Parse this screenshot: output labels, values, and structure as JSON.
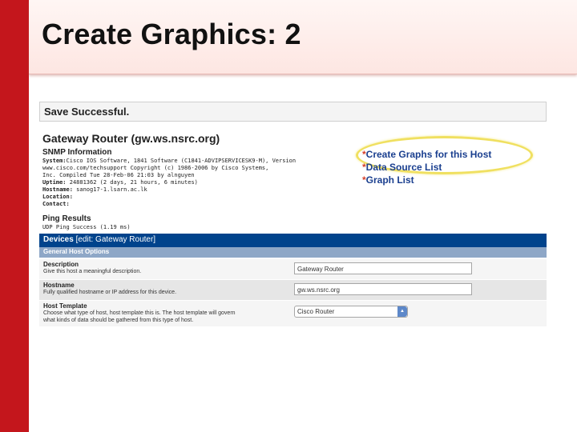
{
  "slide": {
    "title": "Create Graphics: 2"
  },
  "status": {
    "message": "Save Successful."
  },
  "host": {
    "title": "Gateway Router (gw.ws.nsrc.org)"
  },
  "snmp": {
    "heading": "SNMP Information",
    "system_label": "System:",
    "system_line1": "Cisco IOS Software, 1841 Software (C1841-ADVIPSERVICESK9-M), Version",
    "system_line2": "www.cisco.com/techsupport Copyright (c) 1986-2006 by Cisco Systems,",
    "system_line3": "Inc. Compiled Tue 28-Feb-06 21:03 by alnguyen",
    "uptime_label": "Uptime:",
    "uptime_value": "24881362 (2 days, 21 hours, 6 minutes)",
    "hostname_label": "Hostname:",
    "hostname_value": "sanog17-1.lsarn.ac.lk",
    "location_label": "Location:",
    "contact_label": "Contact:"
  },
  "actions": {
    "star": "*",
    "links": [
      "Create Graphs for this Host",
      "Data Source List",
      "Graph List"
    ]
  },
  "ping": {
    "heading": "Ping Results",
    "result": "UDP Ping Success (1.19 ms)"
  },
  "devices": {
    "header_label": "Devices",
    "header_edit": "[edit: Gateway Router]",
    "section": "General Host Options",
    "fields": [
      {
        "label": "Description",
        "desc": "Give this host a meaningful description.",
        "value": "Gateway Router"
      },
      {
        "label": "Hostname",
        "desc": "Fully qualified hostname or IP address for this device.",
        "value": "gw.ws.nsrc.org"
      },
      {
        "label": "Host Template",
        "desc1": "Choose what type of host, host template this is. The host template will govern",
        "desc2": "what kinds of data should be gathered from this type of host.",
        "value": "Cisco Router"
      }
    ]
  },
  "colors": {
    "accent_red": "#c4161c",
    "header_blue": "#00438c",
    "subheader_blue": "#8ea7c7",
    "highlight_yellow": "#f0e060"
  },
  "icons": {
    "select_arrow": "dropdown-arrow-icon"
  }
}
